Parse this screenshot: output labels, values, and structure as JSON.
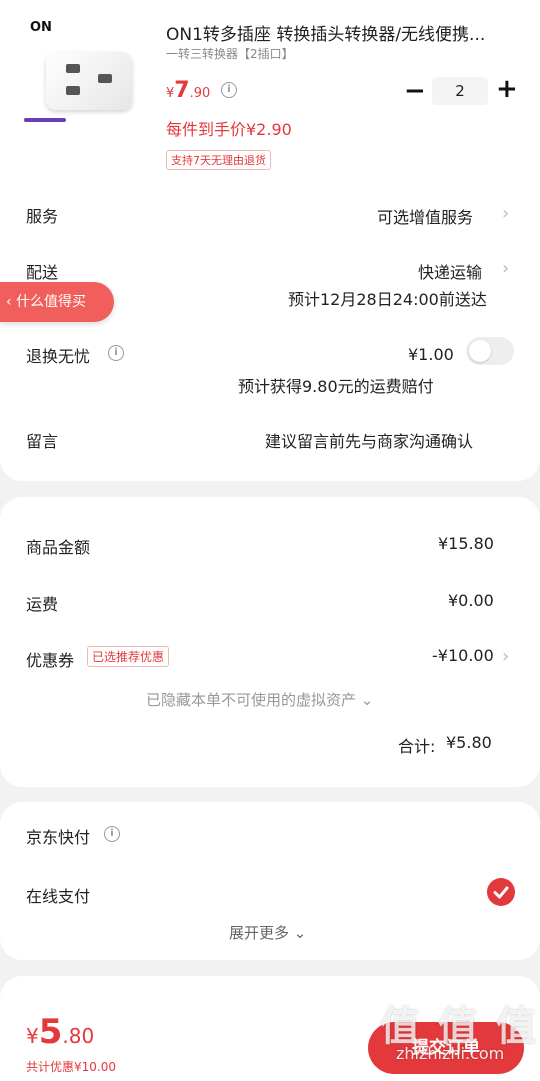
{
  "product": {
    "brand": "ON",
    "title": "ON1转多插座 转换插头转换器/无线便携...",
    "spec": "一转三转换器【2插口】",
    "price_symbol": "¥",
    "price_int": "7",
    "price_dec": ".90",
    "quantity": "2",
    "unit_price": "每件到手价¥2.90",
    "return_tag": "支持7天无理由退货"
  },
  "float_button": {
    "label": "什么值得买"
  },
  "service": {
    "label": "服务",
    "value": "可选增值服务"
  },
  "delivery": {
    "label": "配送",
    "method": "快递运输",
    "eta": "预计12月28日24:00前送达"
  },
  "return_worry": {
    "label": "退换无忧",
    "price": "¥1.00",
    "desc": "预计获得9.80元的运费赔付"
  },
  "message": {
    "label": "留言",
    "placeholder": "建议留言前先与商家沟通确认"
  },
  "summary": {
    "goods_label": "商品金额",
    "goods_value": "¥15.80",
    "shipping_label": "运费",
    "shipping_value": "¥0.00",
    "coupon_label": "优惠券",
    "coupon_tag": "已选推荐优惠",
    "coupon_value": "-¥10.00",
    "hidden_note": "已隐藏本单不可使用的虚拟资产",
    "total_label": "合计:",
    "total_value": "¥5.80"
  },
  "payment": {
    "jd_label": "京东快付",
    "online_label": "在线支付",
    "expand_label": "展开更多"
  },
  "bottom": {
    "symbol": "¥",
    "int": "5",
    "dec": ".80",
    "discount": "共计优惠¥10.00",
    "submit": "提交订单",
    "watermark": "值 值 值",
    "watermark_url": "zhizhizhi.com"
  },
  "colors": {
    "accent": "#e4393c",
    "float": "#f05f5c"
  },
  "icons": [
    "info-icon",
    "chevron-right-icon",
    "chevron-down-icon",
    "check-icon",
    "chevron-left-icon"
  ]
}
